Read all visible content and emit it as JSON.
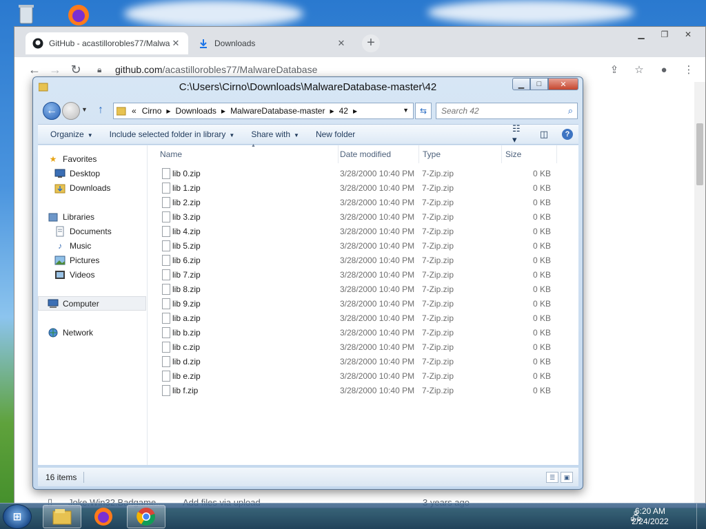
{
  "browser": {
    "tabs": [
      {
        "label": "GitHub - acastillorobles77/Malwa",
        "close": "✕"
      },
      {
        "label": "Downloads",
        "close": "✕"
      }
    ],
    "new_tab": "+",
    "url_host": "github.com",
    "url_path": "/acastillorobles77/MalwareDatabase",
    "page_row": {
      "name": "Joke.Win32.Badgame....",
      "message": "Add files via upload",
      "age": "3 years ago"
    }
  },
  "explorer": {
    "title": "C:\\Users\\Cirno\\Downloads\\MalwareDatabase-master\\42",
    "breadcrumb": [
      "Cirno",
      "Downloads",
      "MalwareDatabase-master",
      "42"
    ],
    "breadcrumb_prefix": "«",
    "search_placeholder": "Search 42",
    "commands": {
      "organize": "Organize",
      "include": "Include selected folder in library",
      "share": "Share with",
      "new_folder": "New folder"
    },
    "nav": {
      "favorites": "Favorites",
      "desktop": "Desktop",
      "downloads": "Downloads",
      "libraries": "Libraries",
      "documents": "Documents",
      "music": "Music",
      "pictures": "Pictures",
      "videos": "Videos",
      "computer": "Computer",
      "network": "Network"
    },
    "columns": {
      "name": "Name",
      "date": "Date modified",
      "type": "Type",
      "size": "Size"
    },
    "files": [
      {
        "name": "lib 0.zip",
        "date": "3/28/2000 10:40 PM",
        "type": "7-Zip.zip",
        "size": "0 KB"
      },
      {
        "name": "lib 1.zip",
        "date": "3/28/2000 10:40 PM",
        "type": "7-Zip.zip",
        "size": "0 KB"
      },
      {
        "name": "lib 2.zip",
        "date": "3/28/2000 10:40 PM",
        "type": "7-Zip.zip",
        "size": "0 KB"
      },
      {
        "name": "lib 3.zip",
        "date": "3/28/2000 10:40 PM",
        "type": "7-Zip.zip",
        "size": "0 KB"
      },
      {
        "name": "lib 4.zip",
        "date": "3/28/2000 10:40 PM",
        "type": "7-Zip.zip",
        "size": "0 KB"
      },
      {
        "name": "lib 5.zip",
        "date": "3/28/2000 10:40 PM",
        "type": "7-Zip.zip",
        "size": "0 KB"
      },
      {
        "name": "lib 6.zip",
        "date": "3/28/2000 10:40 PM",
        "type": "7-Zip.zip",
        "size": "0 KB"
      },
      {
        "name": "lib 7.zip",
        "date": "3/28/2000 10:40 PM",
        "type": "7-Zip.zip",
        "size": "0 KB"
      },
      {
        "name": "lib 8.zip",
        "date": "3/28/2000 10:40 PM",
        "type": "7-Zip.zip",
        "size": "0 KB"
      },
      {
        "name": "lib 9.zip",
        "date": "3/28/2000 10:40 PM",
        "type": "7-Zip.zip",
        "size": "0 KB"
      },
      {
        "name": "lib a.zip",
        "date": "3/28/2000 10:40 PM",
        "type": "7-Zip.zip",
        "size": "0 KB"
      },
      {
        "name": "lib b.zip",
        "date": "3/28/2000 10:40 PM",
        "type": "7-Zip.zip",
        "size": "0 KB"
      },
      {
        "name": "lib c.zip",
        "date": "3/28/2000 10:40 PM",
        "type": "7-Zip.zip",
        "size": "0 KB"
      },
      {
        "name": "lib d.zip",
        "date": "3/28/2000 10:40 PM",
        "type": "7-Zip.zip",
        "size": "0 KB"
      },
      {
        "name": "lib e.zip",
        "date": "3/28/2000 10:40 PM",
        "type": "7-Zip.zip",
        "size": "0 KB"
      },
      {
        "name": "lib f.zip",
        "date": "3/28/2000 10:40 PM",
        "type": "7-Zip.zip",
        "size": "0 KB"
      }
    ],
    "status": "16 items"
  },
  "taskbar": {
    "time": "6:20 AM",
    "date": "2/24/2022",
    "apps": [
      "explorer-icon",
      "firefox-icon",
      "chrome-icon"
    ]
  },
  "colors": {
    "explorer_chrome": "#d7e6f5",
    "taskbar": "#2a4a6e",
    "link_blue": "#2d6fc4"
  }
}
